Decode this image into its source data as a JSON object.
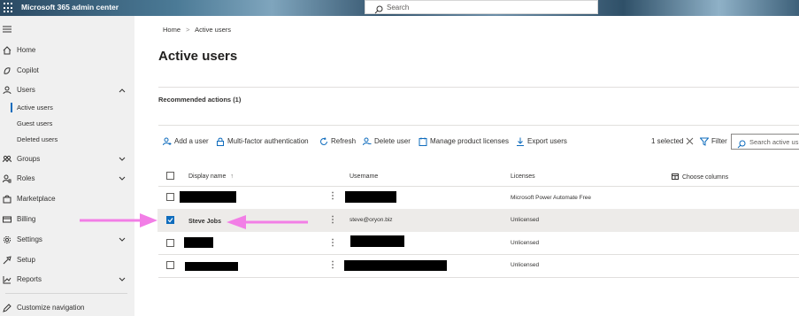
{
  "header": {
    "app_title": "Microsoft 365 admin center",
    "search_placeholder": "Search"
  },
  "sidebar": {
    "items": [
      {
        "label": "Home",
        "icon": "home-icon"
      },
      {
        "label": "Copilot",
        "icon": "copilot-icon"
      },
      {
        "label": "Users",
        "icon": "person-icon",
        "expanded": true
      },
      {
        "label": "Groups",
        "icon": "groups-icon"
      },
      {
        "label": "Roles",
        "icon": "roles-icon"
      },
      {
        "label": "Marketplace",
        "icon": "marketplace-icon"
      },
      {
        "label": "Billing",
        "icon": "billing-icon"
      },
      {
        "label": "Settings",
        "icon": "gear-icon"
      },
      {
        "label": "Setup",
        "icon": "setup-icon"
      },
      {
        "label": "Reports",
        "icon": "reports-icon"
      }
    ],
    "users_sub": [
      "Active users",
      "Guest users",
      "Deleted users"
    ],
    "customize": "Customize navigation"
  },
  "breadcrumb": {
    "home": "Home",
    "sep": ">",
    "current": "Active users"
  },
  "page_title": "Active users",
  "recommended": "Recommended actions (1)",
  "toolbar": {
    "add_user": "Add a user",
    "mfa": "Multi-factor authentication",
    "refresh": "Refresh",
    "delete_user": "Delete user",
    "manage_licenses": "Manage product licenses",
    "export": "Export users",
    "selected": "1 selected",
    "filter": "Filter",
    "search_placeholder": "Search active us"
  },
  "table": {
    "columns": {
      "display_name": "Display name",
      "sort_arrow": "↑",
      "username": "Username",
      "licenses": "Licenses",
      "choose_columns": "Choose columns"
    },
    "rows": [
      {
        "display_name": "",
        "username": "",
        "licenses": "Microsoft Power Automate Free",
        "checked": false
      },
      {
        "display_name": "Steve Jobs",
        "username": "steve@oryon.biz",
        "licenses": "Unlicensed",
        "checked": true
      },
      {
        "display_name": "",
        "username": "",
        "licenses": "Unlicensed",
        "checked": false
      },
      {
        "display_name": "",
        "username": "",
        "licenses": "Unlicensed",
        "checked": false
      }
    ]
  },
  "colors": {
    "accent": "#0f6cbd",
    "annotation_arrow": "#f27ee6",
    "sidebar_bg": "#f0f0f0",
    "selected_row": "#edebe9"
  }
}
